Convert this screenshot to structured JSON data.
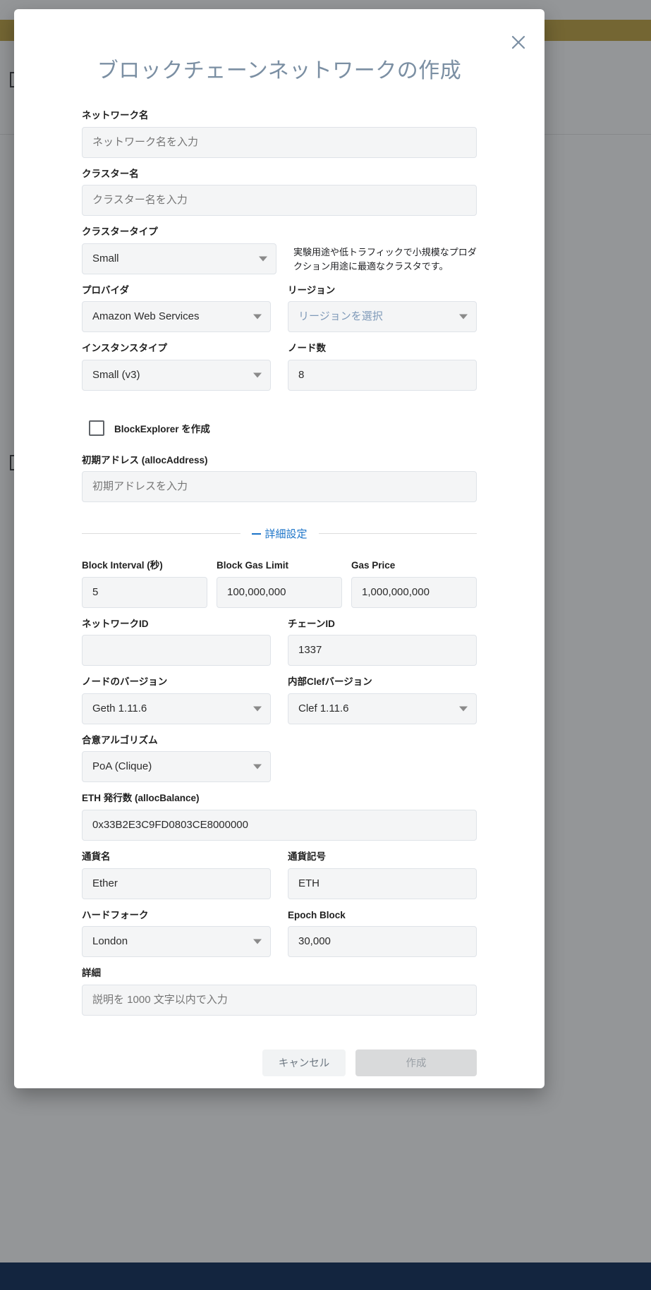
{
  "modal": {
    "title": "ブロックチェーンネットワークの作成",
    "close_icon": "close-icon",
    "fields": {
      "network_name": {
        "label": "ネットワーク名",
        "placeholder": "ネットワーク名を入力",
        "value": ""
      },
      "cluster_name": {
        "label": "クラスター名",
        "placeholder": "クラスター名を入力",
        "value": ""
      },
      "cluster_type": {
        "label": "クラスタータイプ",
        "value": "Small",
        "description": "実験用途や低トラフィックで小規模なプロダクション用途に最適なクラスタです。"
      },
      "provider": {
        "label": "プロバイダ",
        "value": "Amazon Web Services"
      },
      "region": {
        "label": "リージョン",
        "placeholder": "リージョンを選択",
        "value": ""
      },
      "instance_type": {
        "label": "インスタンスタイプ",
        "value": "Small (v3)"
      },
      "node_count": {
        "label": "ノード数",
        "value": "8"
      },
      "block_explorer": {
        "label": "BlockExplorer を作成",
        "checked": false
      },
      "alloc_address": {
        "label": "初期アドレス (allocAddress)",
        "placeholder": "初期アドレスを入力",
        "value": ""
      },
      "block_interval": {
        "label": "Block Interval (秒)",
        "value": "5"
      },
      "block_gas_limit": {
        "label": "Block Gas Limit",
        "value": "100,000,000"
      },
      "gas_price": {
        "label": "Gas Price",
        "value": "1,000,000,000"
      },
      "network_id": {
        "label": "ネットワークID",
        "value": ""
      },
      "chain_id": {
        "label": "チェーンID",
        "value": "1337"
      },
      "node_version": {
        "label": "ノードのバージョン",
        "value": "Geth 1.11.6"
      },
      "clef_version": {
        "label": "内部Clefバージョン",
        "value": "Clef 1.11.6"
      },
      "consensus": {
        "label": "合意アルゴリズム",
        "value": "PoA (Clique)"
      },
      "alloc_balance": {
        "label": "ETH 発行数 (allocBalance)",
        "value": "0x33B2E3C9FD0803CE8000000"
      },
      "currency_name": {
        "label": "通貨名",
        "value": "Ether"
      },
      "currency_symbol": {
        "label": "通貨記号",
        "value": "ETH"
      },
      "hardfork": {
        "label": "ハードフォーク",
        "value": "London"
      },
      "epoch_block": {
        "label": "Epoch Block",
        "value": "30,000"
      },
      "description": {
        "label": "詳細",
        "placeholder": "説明を 1000 文字以内で入力",
        "value": ""
      }
    },
    "advanced_section": {
      "label": "詳細設定",
      "expanded": true,
      "toggle_icon": "minus-icon"
    },
    "footer": {
      "cancel_label": "キャンセル",
      "create_label": "作成",
      "create_disabled": true
    }
  },
  "colors": {
    "title": "#7b8fa3",
    "accent_link": "#1a73c8",
    "field_bg": "#f4f5f6",
    "field_border": "#dfe3e8",
    "placeholder": "#9db0c4",
    "scrim": "rgba(60,64,67,0.55)",
    "bg_topbar": "#b8941f",
    "bg_footer": "#13253f"
  }
}
